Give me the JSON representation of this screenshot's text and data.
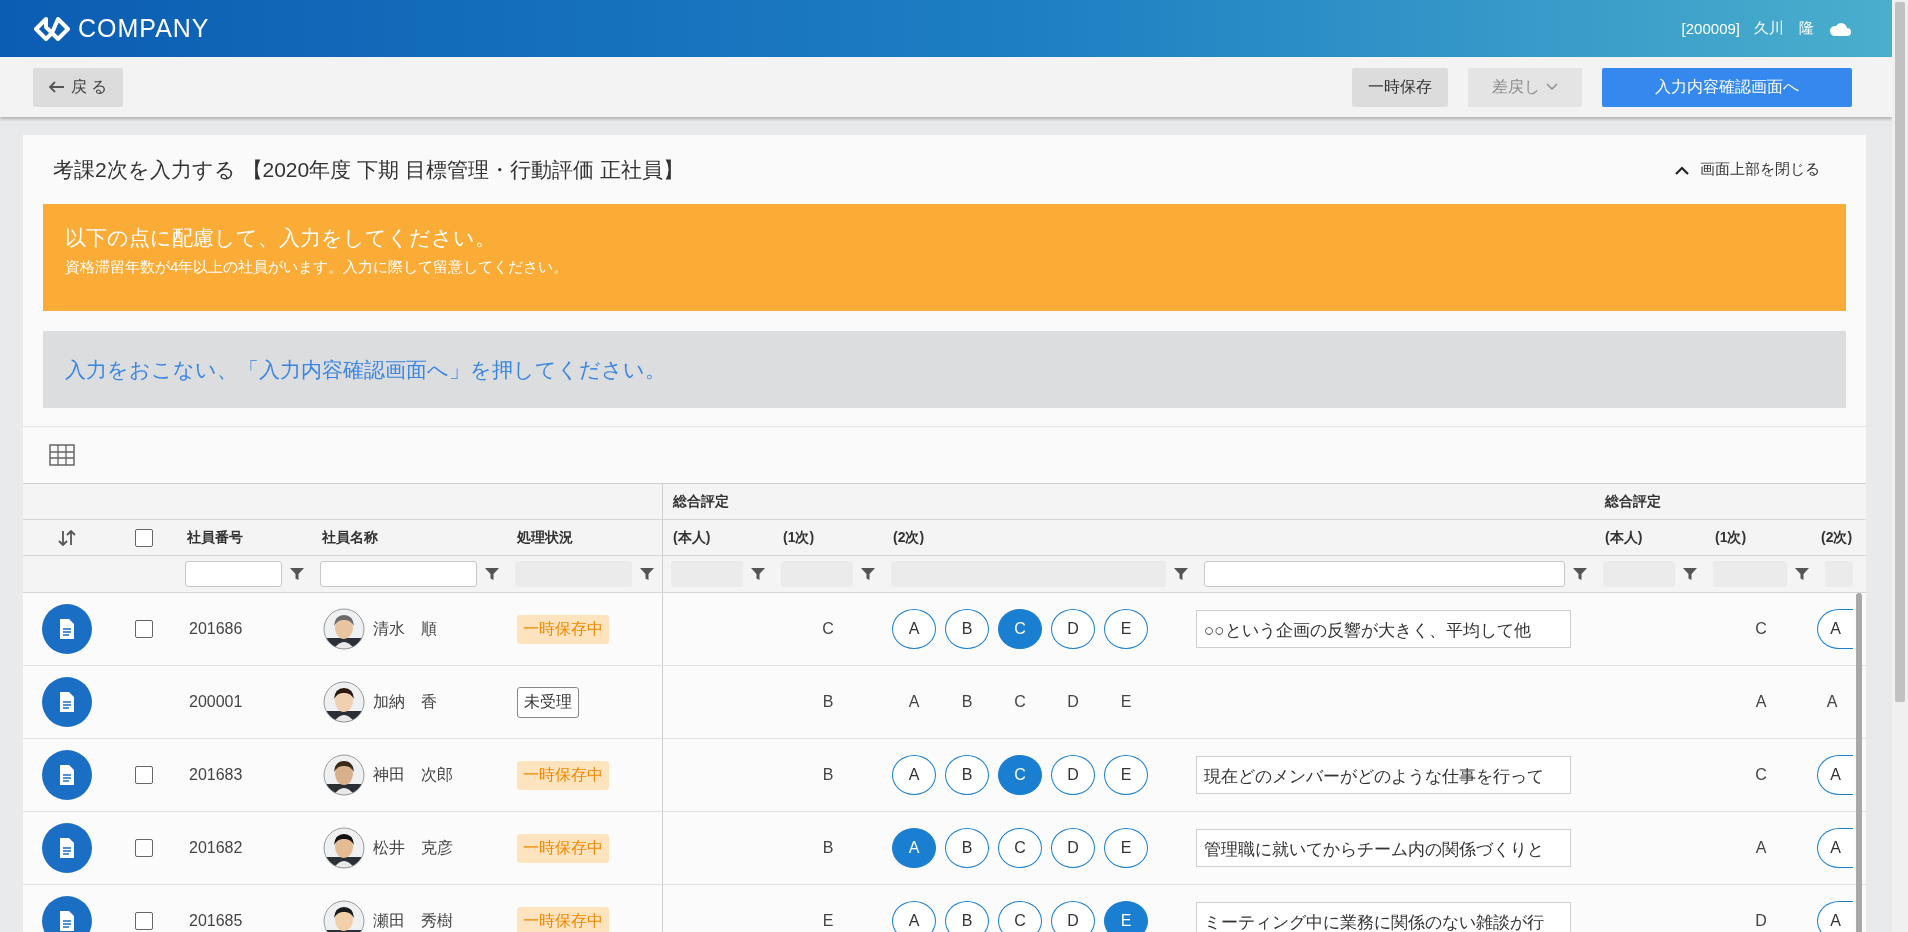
{
  "header": {
    "logo": "COMPANY",
    "user_id": "[200009]",
    "user_name": "久川　隆"
  },
  "toolbar": {
    "back": "戻 る",
    "temp_save": "一時保存",
    "send_back": {
      "label": "差戻し",
      "disabled": true
    },
    "confirm": "入力内容確認画面へ"
  },
  "page": {
    "title": "考課2次を入力する 【2020年度 下期 目標管理・行動評価 正社員】",
    "collapse": "画面上部を閉じる"
  },
  "notice": {
    "heading": "以下の点に配慮して、入力をしてください。",
    "detail": "資格滞留年数が4年以上の社員がいます。入力に際して留意してください。"
  },
  "instruction": "入力をおこない、「入力内容確認画面へ」を押してください。",
  "table": {
    "group_headers": [
      "総合評定",
      "総合評定"
    ],
    "select_all_checked": false,
    "columns": [
      {
        "label": "社員番号",
        "filter_disabled": false
      },
      {
        "label": "社員名称",
        "filter_disabled": false
      },
      {
        "label": "処理状況",
        "filter_disabled": true
      },
      {
        "label": "(本人)",
        "filter_disabled": true
      },
      {
        "label": "(1次)",
        "filter_disabled": true
      },
      {
        "label": "(2次)",
        "filter_disabled": true
      },
      {
        "filter_disabled": false
      },
      {
        "label": "(本人)",
        "filter_disabled": true
      },
      {
        "label": "(1次)",
        "filter_disabled": true
      },
      {
        "label": "(2次)",
        "filter_disabled": true
      }
    ],
    "rows": [
      {
        "number": "201686",
        "name": "清水　順",
        "status": {
          "kind": "saved",
          "label": "一時保存中"
        },
        "selectable": true,
        "checked": false,
        "first": "C",
        "editable": true,
        "grades": [
          {
            "label": "A",
            "selected": false
          },
          {
            "label": "B",
            "selected": false
          },
          {
            "label": "C",
            "selected": true
          },
          {
            "label": "D",
            "selected": false
          },
          {
            "label": "E",
            "selected": false
          }
        ],
        "comment": "○○という企画の反響が大きく、平均して他",
        "second_first": "C",
        "second_grade": "A"
      },
      {
        "number": "200001",
        "name": "加納　香",
        "status": {
          "kind": "unreceived",
          "label": "未受理"
        },
        "selectable": false,
        "first": "B",
        "editable": false,
        "grades": [
          {
            "label": "A",
            "selected": false
          },
          {
            "label": "B",
            "selected": false
          },
          {
            "label": "C",
            "selected": false
          },
          {
            "label": "D",
            "selected": false
          },
          {
            "label": "E",
            "selected": false
          }
        ],
        "second_first": "A",
        "second_grade": "A"
      },
      {
        "number": "201683",
        "name": "神田　次郎",
        "status": {
          "kind": "saved",
          "label": "一時保存中"
        },
        "selectable": true,
        "checked": false,
        "first": "B",
        "editable": true,
        "grades": [
          {
            "label": "A",
            "selected": false
          },
          {
            "label": "B",
            "selected": false
          },
          {
            "label": "C",
            "selected": true
          },
          {
            "label": "D",
            "selected": false
          },
          {
            "label": "E",
            "selected": false
          }
        ],
        "comment": "現在どのメンバーがどのような仕事を行って",
        "second_first": "C",
        "second_grade": "A"
      },
      {
        "number": "201682",
        "name": "松井　克彦",
        "status": {
          "kind": "saved",
          "label": "一時保存中"
        },
        "selectable": true,
        "checked": false,
        "first": "B",
        "editable": true,
        "grades": [
          {
            "label": "A",
            "selected": true
          },
          {
            "label": "B",
            "selected": false
          },
          {
            "label": "C",
            "selected": false
          },
          {
            "label": "D",
            "selected": false
          },
          {
            "label": "E",
            "selected": false
          }
        ],
        "comment": "管理職に就いてからチーム内の関係づくりと",
        "second_first": "A",
        "second_grade": "A"
      },
      {
        "number": "201685",
        "name": "瀬田　秀樹",
        "status": {
          "kind": "saved",
          "label": "一時保存中"
        },
        "selectable": true,
        "checked": false,
        "first": "E",
        "editable": true,
        "grades": [
          {
            "label": "A",
            "selected": false
          },
          {
            "label": "B",
            "selected": false
          },
          {
            "label": "C",
            "selected": false
          },
          {
            "label": "D",
            "selected": false
          },
          {
            "label": "E",
            "selected": true
          }
        ],
        "comment": "ミーティング中に業務に関係のない雑談が行",
        "second_first": "D",
        "second_grade": "A"
      }
    ]
  }
}
